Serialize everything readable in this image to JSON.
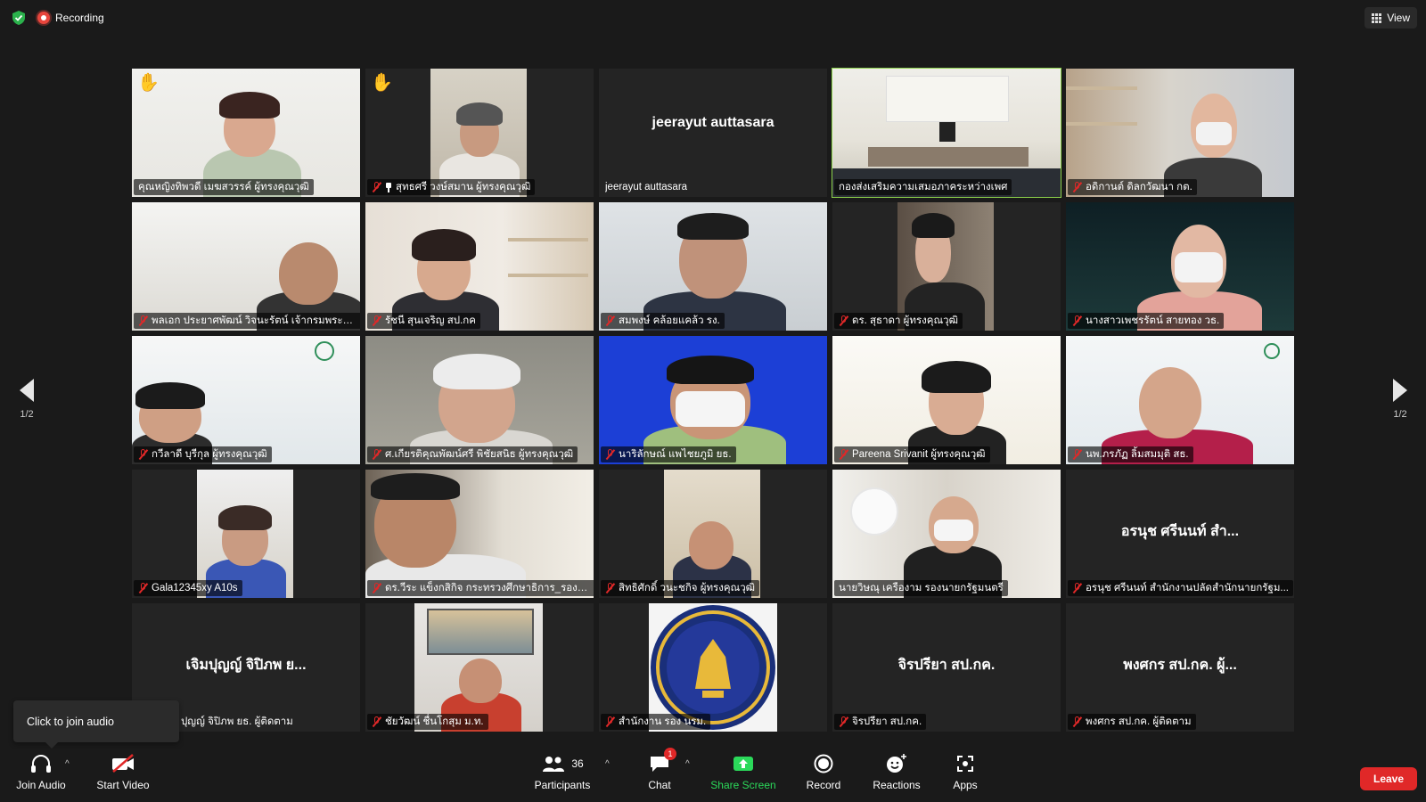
{
  "topbar": {
    "shield_icon": "shield-check-icon",
    "recording_label": "Recording",
    "view_label": "View"
  },
  "colors": {
    "background": "#1a1a1a",
    "tile_bg": "#242424",
    "active_speaker": "#8cd24b",
    "mute": "#e02828",
    "share_screen": "#2bd95a",
    "leave": "#e02828",
    "record": "#e8453c"
  },
  "tiles": [
    {
      "name": "คุณหญิงทิพวดี เมฆสวรรค์ ผู้ทรงคุณวุฒิ",
      "hand": true
    },
    {
      "name": "สุทธศรี วงษ์สมาน ผู้ทรงคุณวุฒิ",
      "hand": true,
      "pinned": true
    },
    {
      "name": "jeerayut auttasara",
      "big_name": "jeerayut auttasara"
    },
    {
      "name": "กองส่งเสริมความเสมอภาคระหว่างเพศ",
      "active": true
    },
    {
      "name": "อดิกานต์ ดิลกวัฒนา กต."
    },
    {
      "name": "พลเอก ประยาศพัฒน์ วิจนะรัตน์ เจ้ากรมพระธร..."
    },
    {
      "name": "รัชนี สุนเจริญ สป.กค"
    },
    {
      "name": "สมพงษ์ คล้อยแคล้ว รง."
    },
    {
      "name": "ดร. สุธาดา ผู้ทรงคุณวุฒิ"
    },
    {
      "name": "นางสาวเพชรรัตน์ สายทอง วธ."
    },
    {
      "name": "กวีลาดี บุรีกุล ผู้ทรงคุณวุฒิ"
    },
    {
      "name": "ศ.เกียรติคุณพัฒน์ศรี พิชัยสนิธ ผู้ทรงคุณวุฒิ"
    },
    {
      "name": "นาริลักษณ์ แพไชยภูมิ ยธ."
    },
    {
      "name": "Pareena Srivanit ผู้ทรงคุณวุฒิ"
    },
    {
      "name": "นพ.ภรภัฏ ลิ้มสมมุติ สธ."
    },
    {
      "name": "Gala12345xy A10s"
    },
    {
      "name": "ดร.วีระ แข็งกสิกิจ กระทรวงศึกษาธิการ_รองปล..."
    },
    {
      "name": "สิทธิศักดิ์ วนะชกิจ ผู้ทรงคุณวุฒิ"
    },
    {
      "name": "นายวิษณุ เครืองาม รองนายกรัฐมนตรี",
      "no_mute": true
    },
    {
      "name": "อรนุช ศรีนนท์ สำนักงานปลัดสำนักนายกรัฐม...",
      "big_name": "อรนุช ศรีนนท์ สำ..."
    },
    {
      "name": "ปุญญ์ จิปิภพ ยธ. ผู้ติดตาม",
      "big_name": "เจิมปุญญ์ จิปิภพ ย...",
      "no_mute": true
    },
    {
      "name": "ชัยวัฒน์ ชื่นโกสุม ม.ท."
    },
    {
      "name": "สำนักงาน รอง นรม."
    },
    {
      "name": "จิรปรียา สป.กค. ",
      "big_name": "จิรปรียา สป.กค."
    },
    {
      "name": "พงศกร สป.กค. ผู้ติดตาม",
      "big_name": "พงศกร สป.กค. ผู้..."
    }
  ],
  "pager": {
    "left": "1/2",
    "right": "1/2"
  },
  "tooltip": "Click to join audio",
  "toolbar": {
    "join_audio": "Join Audio",
    "start_video": "Start Video",
    "participants": "Participants",
    "participants_count": "36",
    "chat": "Chat",
    "chat_badge": "1",
    "share_screen": "Share Screen",
    "record": "Record",
    "reactions": "Reactions",
    "apps": "Apps",
    "leave": "Leave"
  }
}
